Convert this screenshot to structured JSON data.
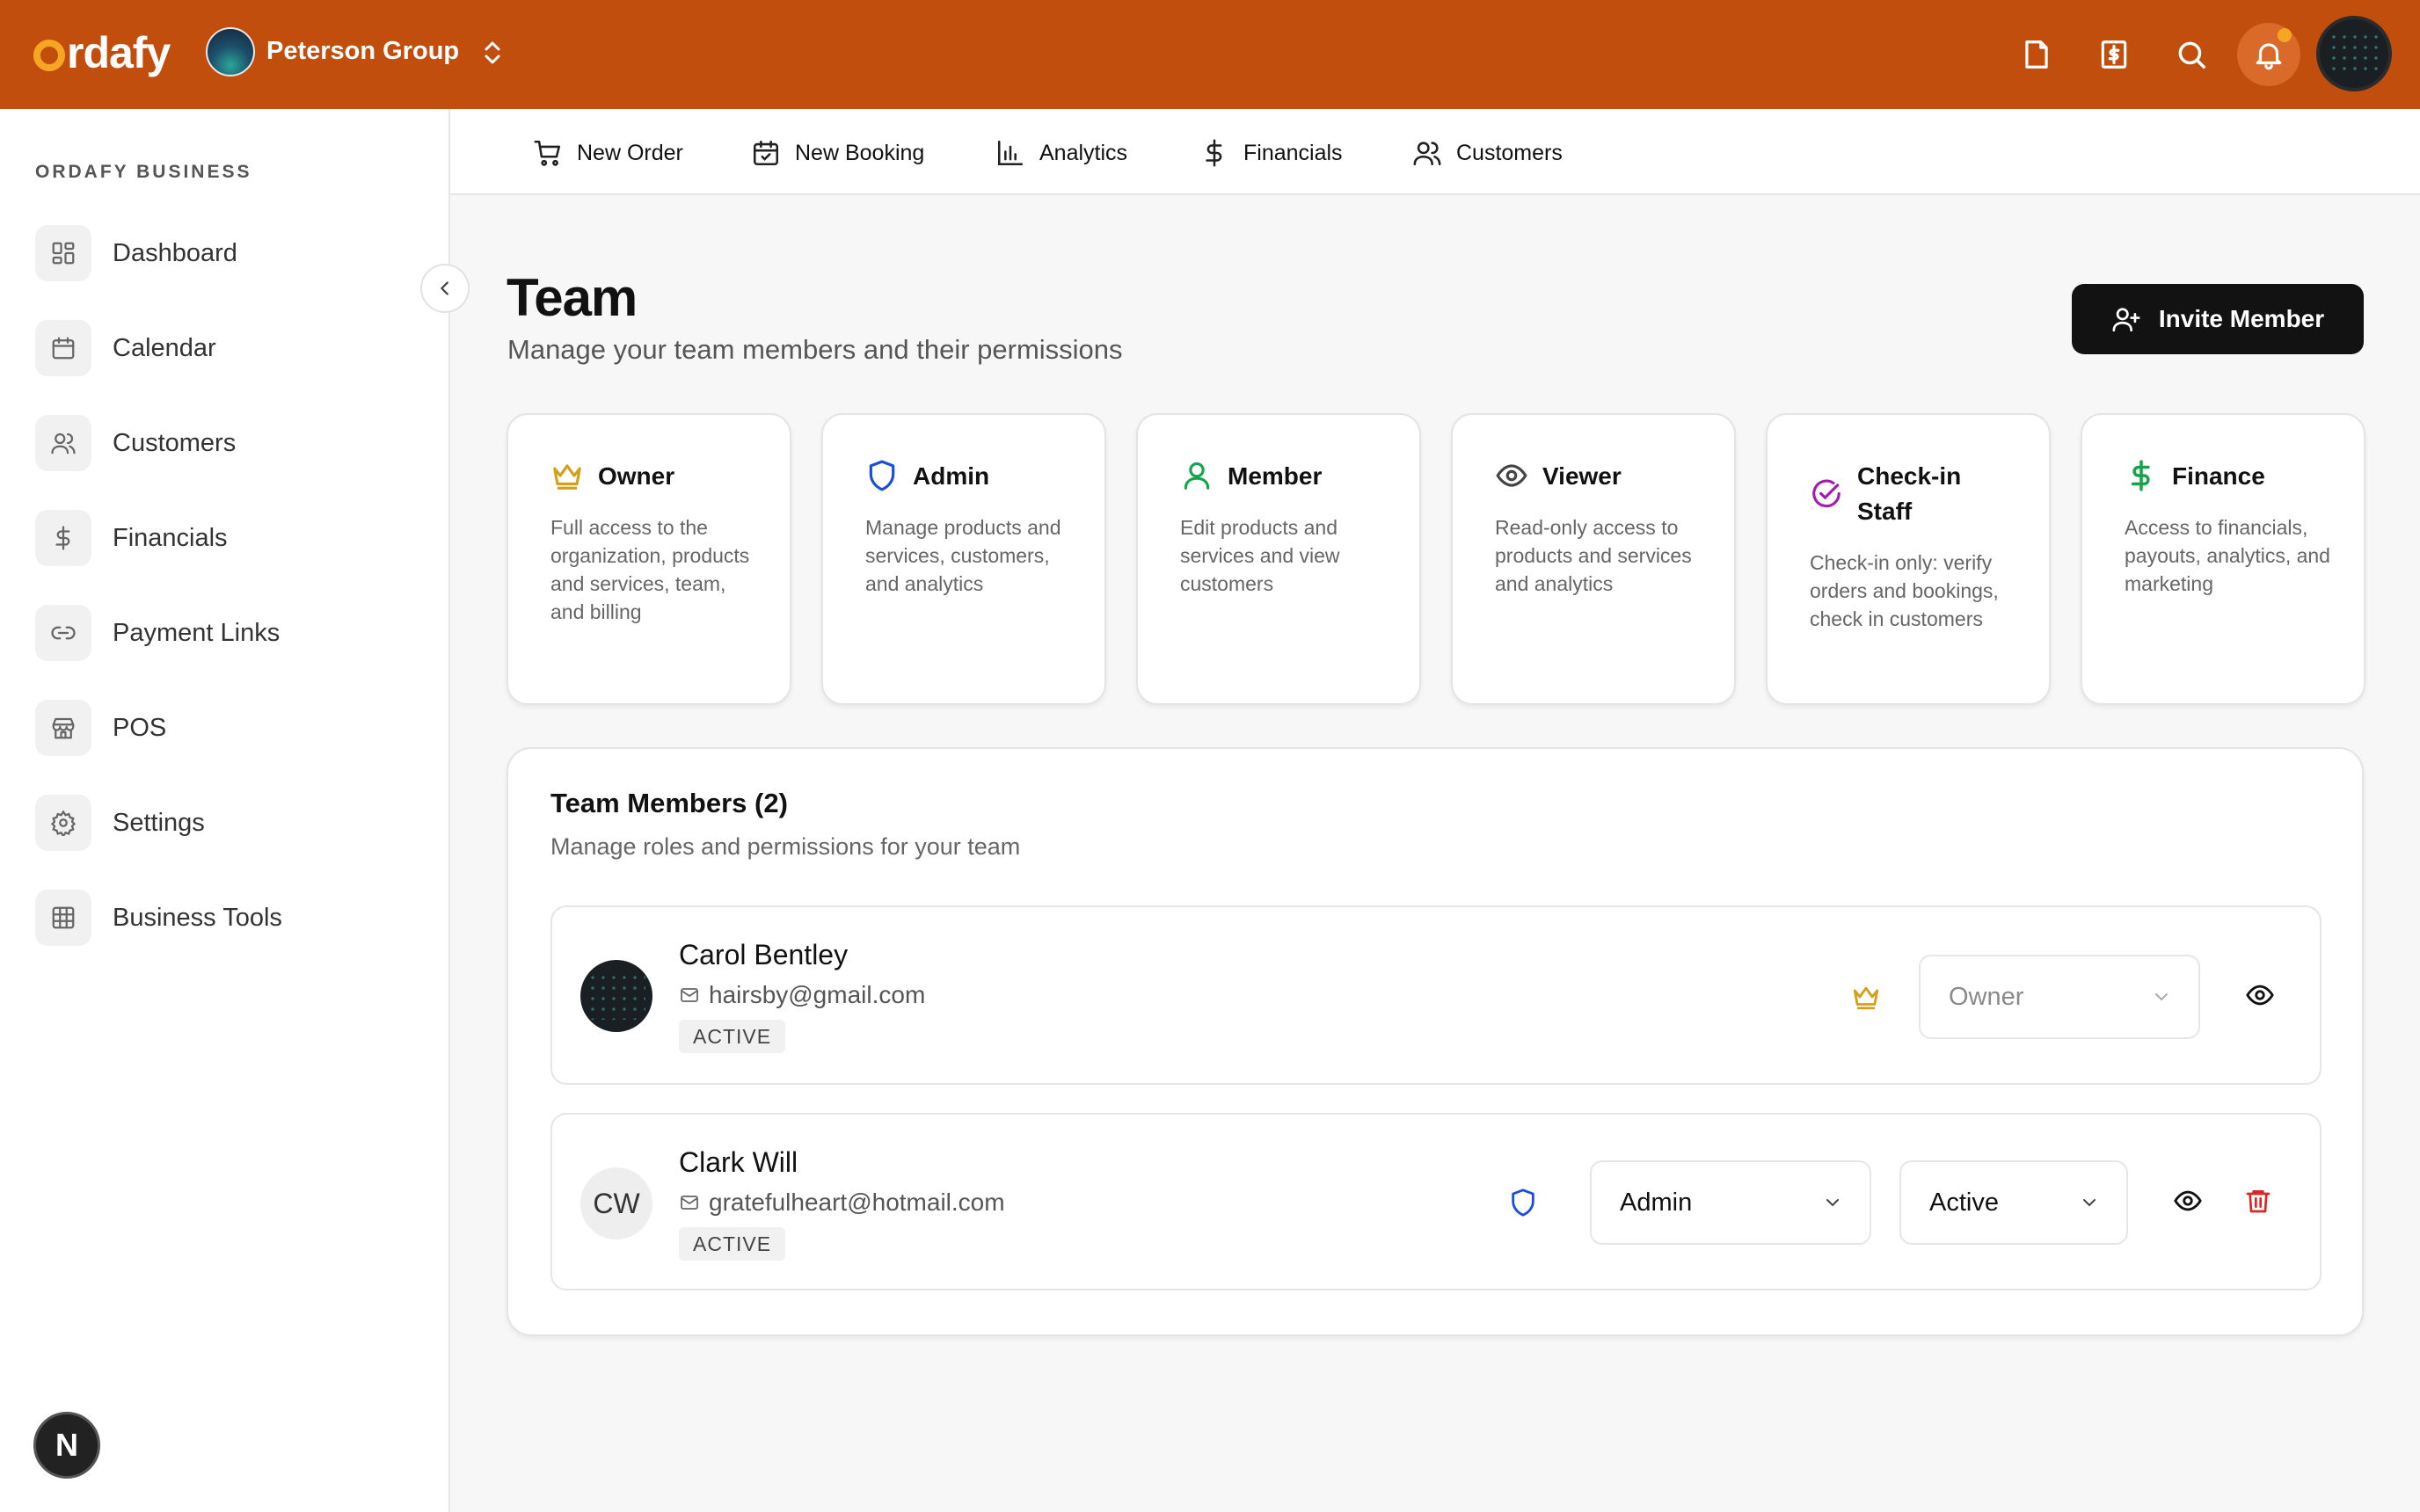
{
  "brand": {
    "logo_text": "rdafy",
    "accent": "#c24e0d"
  },
  "org": {
    "name": "Peterson Group"
  },
  "topbar_icons": [
    "document-icon",
    "receipt-dollar-icon",
    "search-icon",
    "bell-icon",
    "user-avatar"
  ],
  "sidebar": {
    "section_title": "ORDAFY BUSINESS",
    "items": [
      {
        "label": "Dashboard",
        "icon": "dashboard-icon"
      },
      {
        "label": "Calendar",
        "icon": "calendar-icon"
      },
      {
        "label": "Customers",
        "icon": "users-icon"
      },
      {
        "label": "Financials",
        "icon": "dollar-icon"
      },
      {
        "label": "Payment Links",
        "icon": "link-icon"
      },
      {
        "label": "POS",
        "icon": "store-icon"
      },
      {
        "label": "Settings",
        "icon": "gear-icon"
      },
      {
        "label": "Business Tools",
        "icon": "grid-icon"
      }
    ],
    "badge": "N"
  },
  "quick_actions": [
    {
      "label": "New Order",
      "icon": "cart-icon"
    },
    {
      "label": "New Booking",
      "icon": "calendar-check-icon"
    },
    {
      "label": "Analytics",
      "icon": "bar-chart-icon"
    },
    {
      "label": "Financials",
      "icon": "dollar-icon"
    },
    {
      "label": "Customers",
      "icon": "users-icon"
    }
  ],
  "page": {
    "title": "Team",
    "subtitle": "Manage your team members and their permissions",
    "invite_button": "Invite Member"
  },
  "roles": [
    {
      "name": "Owner",
      "icon": "crown-icon",
      "color": "#d4a017",
      "description": "Full access to the organization, products and services, team, and billing"
    },
    {
      "name": "Admin",
      "icon": "shield-icon",
      "color": "#1d4ed8",
      "description": "Manage products and services, customers, and analytics"
    },
    {
      "name": "Member",
      "icon": "user-icon",
      "color": "#16a34a",
      "description": "Edit products and services and view customers"
    },
    {
      "name": "Viewer",
      "icon": "eye-icon",
      "color": "#444444",
      "description": "Read-only access to products and services and analytics"
    },
    {
      "name": "Check-in Staff",
      "icon": "check-circle-icon",
      "color": "#a21caf",
      "description": "Check-in only: verify orders and bookings, check in customers"
    },
    {
      "name": "Finance",
      "icon": "dollar-icon",
      "color": "#16a34a",
      "description": "Access to financials, payouts, analytics, and marketing"
    }
  ],
  "members_panel": {
    "title": "Team Members (2)",
    "subtitle": "Manage roles and permissions for your team",
    "members": [
      {
        "name": "Carol Bentley",
        "email": "hairsby@gmail.com",
        "status": "ACTIVE",
        "role": "Owner",
        "role_icon": "crown-icon"
      },
      {
        "name": "Clark Will",
        "initials": "CW",
        "email": "gratefulheart@hotmail.com",
        "status": "ACTIVE",
        "role": "Admin",
        "role_icon": "shield-icon",
        "state": "Active"
      }
    ]
  }
}
